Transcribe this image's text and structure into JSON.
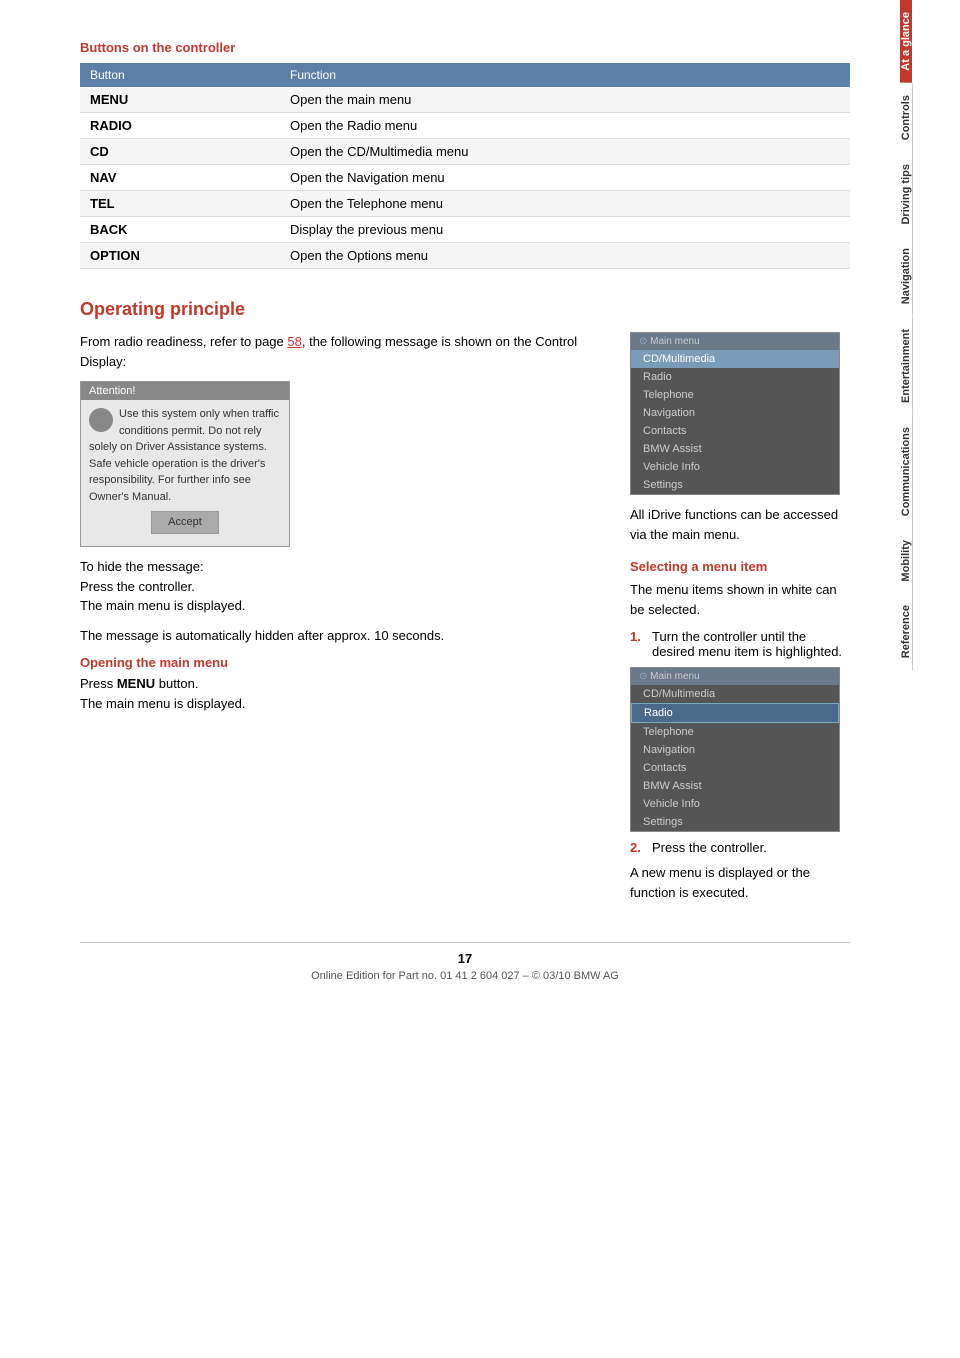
{
  "page": {
    "number": "17",
    "footer_text": "Online Edition for Part no. 01 41 2 604 027 – © 03/10 BMW AG"
  },
  "sidebar": {
    "tabs": [
      {
        "id": "at-a-glance",
        "label": "At a glance",
        "active": true
      },
      {
        "id": "controls",
        "label": "Controls",
        "active": false
      },
      {
        "id": "driving-tips",
        "label": "Driving tips",
        "active": false
      },
      {
        "id": "navigation",
        "label": "Navigation",
        "active": false
      },
      {
        "id": "entertainment",
        "label": "Entertainment",
        "active": false
      },
      {
        "id": "communications",
        "label": "Communications",
        "active": false
      },
      {
        "id": "mobility",
        "label": "Mobility",
        "active": false
      },
      {
        "id": "reference",
        "label": "Reference",
        "active": false
      }
    ]
  },
  "buttons_section": {
    "title": "Buttons on the controller",
    "table": {
      "headers": [
        "Button",
        "Function"
      ],
      "rows": [
        {
          "button": "MENU",
          "function": "Open the main menu"
        },
        {
          "button": "RADIO",
          "function": "Open the Radio menu"
        },
        {
          "button": "CD",
          "function": "Open the CD/Multimedia menu"
        },
        {
          "button": "NAV",
          "function": "Open the Navigation menu"
        },
        {
          "button": "TEL",
          "function": "Open the Telephone menu"
        },
        {
          "button": "BACK",
          "function": "Display the previous menu"
        },
        {
          "button": "OPTION",
          "function": "Open the Options menu"
        }
      ]
    }
  },
  "operating_section": {
    "title": "Operating principle",
    "intro_text": "From radio readiness, refer to page 58, the following message is shown on the Control Display:",
    "attention_box": {
      "header": "Attention!",
      "lines": [
        "Use this system only when traffic",
        "conditions permit. Do not rely solely",
        "on Driver Assistance systems.",
        "Safe vehicle operation is the",
        "driver's responsibility.",
        "For further info see Owner's Manual."
      ],
      "button_label": "Accept"
    },
    "hide_message_text": "To hide the message:\nPress the controller.\nThe main menu is displayed.",
    "auto_hidden_text": "The message is automatically hidden after approx. 10 seconds.",
    "opening_main_menu": {
      "title": "Opening the main menu",
      "text_part1": "Press ",
      "bold_word": "MENU",
      "text_part2": " button.",
      "second_line": "The main menu is displayed."
    },
    "main_menu_label": "Main menu",
    "main_menu_items": [
      {
        "label": "CD/Multimedia",
        "highlighted": true
      },
      {
        "label": "Radio",
        "highlighted": false
      },
      {
        "label": "Telephone",
        "highlighted": false
      },
      {
        "label": "Navigation",
        "highlighted": false
      },
      {
        "label": "Contacts",
        "highlighted": false
      },
      {
        "label": "BMW Assist",
        "highlighted": false
      },
      {
        "label": "Vehicle Info",
        "highlighted": false
      },
      {
        "label": "Settings",
        "highlighted": false
      }
    ],
    "all_idrive_text": "All iDrive functions can be accessed via the main menu.",
    "selecting_menu_item": {
      "title": "Selecting a menu item",
      "intro": "The menu items shown in white can be selected.",
      "step1": "Turn the controller until the desired menu item is highlighted.",
      "main_menu_label2": "Main menu",
      "main_menu_items2": [
        {
          "label": "CD/Multimedia",
          "highlighted": false
        },
        {
          "label": "Radio",
          "highlighted": true,
          "selected": true
        },
        {
          "label": "Telephone",
          "highlighted": false
        },
        {
          "label": "Navigation",
          "highlighted": false
        },
        {
          "label": "Contacts",
          "highlighted": false
        },
        {
          "label": "BMW Assist",
          "highlighted": false
        },
        {
          "label": "Vehicle Info",
          "highlighted": false
        },
        {
          "label": "Settings",
          "highlighted": false
        }
      ],
      "step2": "Press the controller.",
      "outcome": "A new menu is displayed or the function is executed."
    }
  }
}
